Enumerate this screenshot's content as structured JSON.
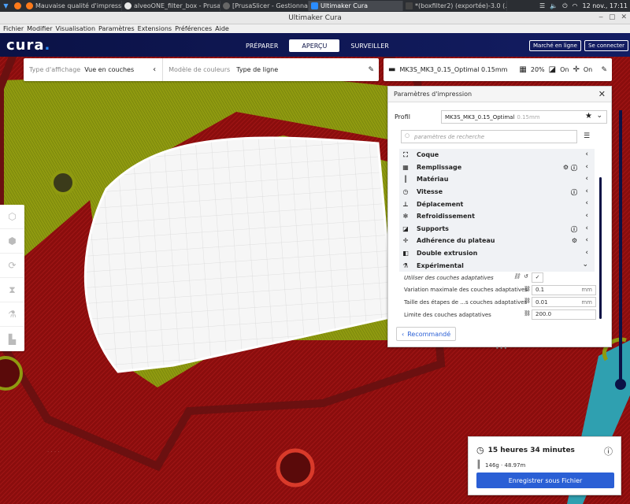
{
  "taskbar": {
    "tasks": [
      {
        "label": "Mauvaise qualité d'impressi..."
      },
      {
        "label": "alveoONE_filter_box - PrusaS..."
      },
      {
        "label": "[PrusaSlicer - Gestionnaire d..."
      },
      {
        "label": "Ultimaker Cura"
      },
      {
        "label": "*(boxfilter2) (exportée)-3.0 (..."
      }
    ],
    "date": "12 nov.,",
    "time": "17:11"
  },
  "window": {
    "title": "Ultimaker Cura"
  },
  "menu": [
    "Fichier",
    "Modifier",
    "Visualisation",
    "Paramètres",
    "Extensions",
    "Préférences",
    "Aide"
  ],
  "header": {
    "logo": "cura",
    "stages": [
      "PRÉPARER",
      "APERÇU",
      "SURVEILLER"
    ],
    "marketplace": "Marché en ligne",
    "signin": "Se connecter"
  },
  "viewbar": {
    "view_type_label": "Type d'affichage",
    "view_type_value": "Vue en couches",
    "color_scheme_label": "Modèle de couleurs",
    "color_scheme_value": "Type de ligne"
  },
  "printbar": {
    "profile": "MK3S_MK3_0.15_Optimal 0.15mm",
    "infill": "20%",
    "support": "On",
    "adhesion": "On"
  },
  "panel": {
    "title": "Paramètres d'impression",
    "profile_label": "Profil",
    "profile_value": "MK3S_MK3_0.15_Optimal",
    "profile_suffix": "0.15mm",
    "search_placeholder": "paramètres de recherche",
    "categories": [
      {
        "label": "Coque"
      },
      {
        "label": "Remplissage"
      },
      {
        "label": "Matériau"
      },
      {
        "label": "Vitesse"
      },
      {
        "label": "Déplacement"
      },
      {
        "label": "Refroidissement"
      },
      {
        "label": "Supports"
      },
      {
        "label": "Adhérence du plateau"
      },
      {
        "label": "Double extrusion"
      },
      {
        "label": "Expérimental"
      }
    ],
    "settings": [
      {
        "label": "Utiliser des couches adaptatives",
        "value": "✓"
      },
      {
        "label": "Variation maximale des couches adaptatives",
        "value": "0.1",
        "unit": "mm"
      },
      {
        "label": "Taille des étapes de ...s couches adaptatives",
        "value": "0.01",
        "unit": "mm"
      },
      {
        "label": "Limite des couches adaptatives",
        "value": "200.0"
      }
    ],
    "recommended": "Recommandé"
  },
  "info": {
    "time": "15 heures 34 minutes",
    "material": "146g · 48.97m",
    "save": "Enregistrer sous Fichier"
  },
  "colors": {
    "header_bg": "#0b1246",
    "accent": "#2a5fd5",
    "wall": "#8a0d0d",
    "infill": "#8f9a10",
    "bed": "#f4f4f4"
  }
}
